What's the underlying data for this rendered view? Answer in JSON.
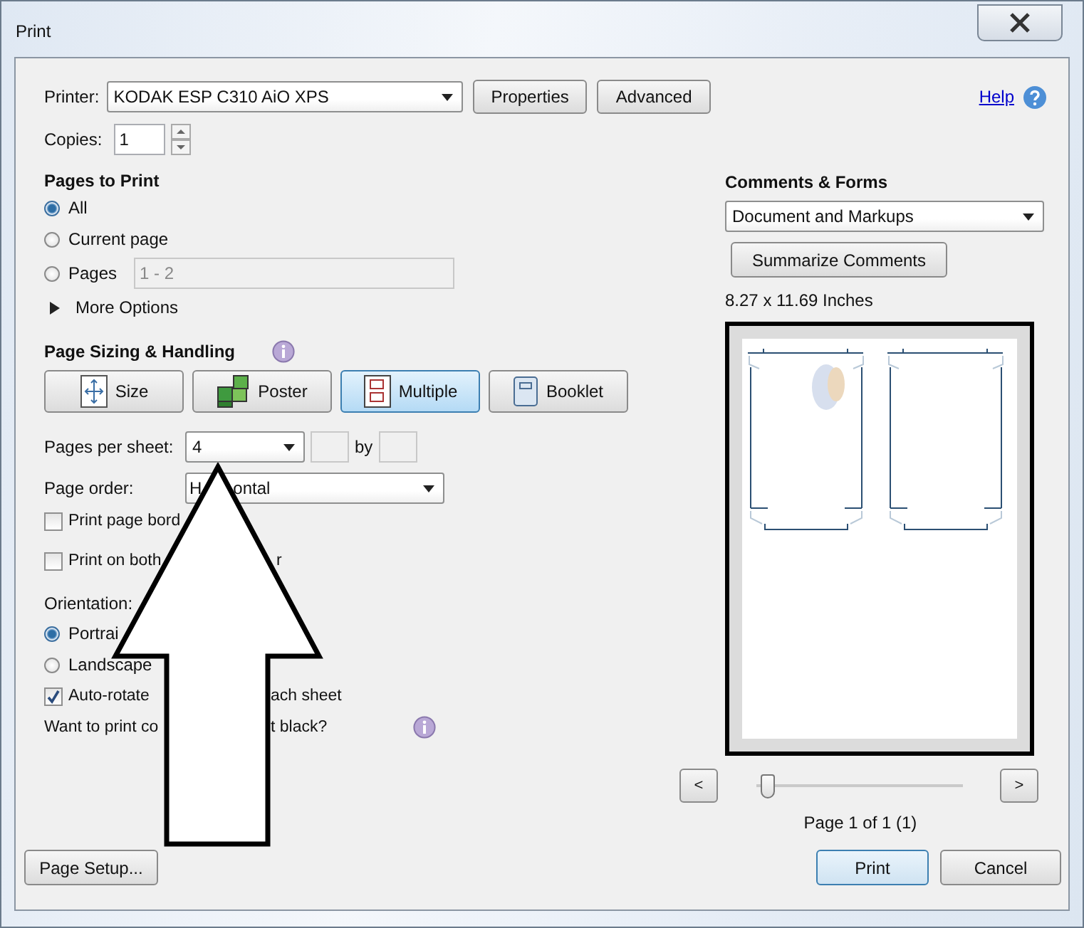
{
  "window": {
    "title": "Print"
  },
  "printer": {
    "label": "Printer:",
    "value": "KODAK ESP C310 AiO XPS"
  },
  "header_buttons": [
    "Properties",
    "Advanced"
  ],
  "help_link": "Help",
  "copies": {
    "label": "Copies:",
    "value": "1"
  },
  "pages_to_print": {
    "heading": "Pages to Print",
    "options": [
      {
        "label": "All",
        "selected": true
      },
      {
        "label": "Current page",
        "selected": false
      },
      {
        "label": "Pages",
        "selected": false,
        "range": "1 - 2"
      }
    ],
    "more_options": "More Options"
  },
  "page_sizing": {
    "heading": "Page Sizing & Handling",
    "modes": [
      {
        "kind": "size",
        "label": "Size",
        "selected": false
      },
      {
        "kind": "poster",
        "label": "Poster",
        "selected": false
      },
      {
        "kind": "multiple",
        "label": "Multiple",
        "selected": true
      },
      {
        "kind": "booklet",
        "label": "Booklet",
        "selected": false
      }
    ]
  },
  "pages_per_sheet": {
    "label": "Pages per sheet:",
    "value": "4",
    "by": "by"
  },
  "page_order": {
    "label": "Page order:",
    "value_parts": [
      "H",
      "ontal"
    ]
  },
  "options": [
    {
      "label_parts": [
        "Print page bord"
      ],
      "checked": false
    },
    {
      "label_parts": [
        "Print on both",
        "r"
      ],
      "checked": false
    }
  ],
  "orientation": {
    "label": "Orientation:",
    "choices": [
      {
        "label": "Portrai",
        "selected": true
      },
      {
        "label": "Landscape",
        "selected": false
      }
    ]
  },
  "auto_rotate": {
    "label_parts": [
      "Auto-rotate",
      "ach sheet"
    ],
    "checked": true
  },
  "color_question": [
    "Want to print co",
    "t black?"
  ],
  "page_setup": "Page Setup...",
  "comments_forms": {
    "heading": "Comments & Forms",
    "value": "Document and Markups",
    "summarize": "Summarize Comments"
  },
  "paper_size": "8.27 x 11.69 Inches",
  "preview": {
    "prev": "<",
    "next": ">",
    "level": 0.02,
    "page_label": "Page 1 of 1 (1)"
  },
  "buttons": [
    "Print",
    "Cancel"
  ]
}
